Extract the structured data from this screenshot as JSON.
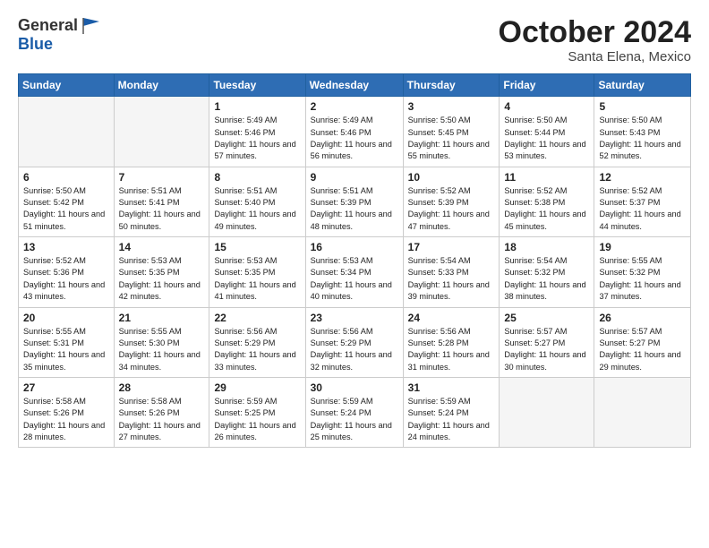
{
  "header": {
    "logo_line1": "General",
    "logo_line2": "Blue",
    "month": "October 2024",
    "location": "Santa Elena, Mexico"
  },
  "weekdays": [
    "Sunday",
    "Monday",
    "Tuesday",
    "Wednesday",
    "Thursday",
    "Friday",
    "Saturday"
  ],
  "weeks": [
    [
      {
        "day": "",
        "info": ""
      },
      {
        "day": "",
        "info": ""
      },
      {
        "day": "1",
        "info": "Sunrise: 5:49 AM\nSunset: 5:46 PM\nDaylight: 11 hours and 57 minutes."
      },
      {
        "day": "2",
        "info": "Sunrise: 5:49 AM\nSunset: 5:46 PM\nDaylight: 11 hours and 56 minutes."
      },
      {
        "day": "3",
        "info": "Sunrise: 5:50 AM\nSunset: 5:45 PM\nDaylight: 11 hours and 55 minutes."
      },
      {
        "day": "4",
        "info": "Sunrise: 5:50 AM\nSunset: 5:44 PM\nDaylight: 11 hours and 53 minutes."
      },
      {
        "day": "5",
        "info": "Sunrise: 5:50 AM\nSunset: 5:43 PM\nDaylight: 11 hours and 52 minutes."
      }
    ],
    [
      {
        "day": "6",
        "info": "Sunrise: 5:50 AM\nSunset: 5:42 PM\nDaylight: 11 hours and 51 minutes."
      },
      {
        "day": "7",
        "info": "Sunrise: 5:51 AM\nSunset: 5:41 PM\nDaylight: 11 hours and 50 minutes."
      },
      {
        "day": "8",
        "info": "Sunrise: 5:51 AM\nSunset: 5:40 PM\nDaylight: 11 hours and 49 minutes."
      },
      {
        "day": "9",
        "info": "Sunrise: 5:51 AM\nSunset: 5:39 PM\nDaylight: 11 hours and 48 minutes."
      },
      {
        "day": "10",
        "info": "Sunrise: 5:52 AM\nSunset: 5:39 PM\nDaylight: 11 hours and 47 minutes."
      },
      {
        "day": "11",
        "info": "Sunrise: 5:52 AM\nSunset: 5:38 PM\nDaylight: 11 hours and 45 minutes."
      },
      {
        "day": "12",
        "info": "Sunrise: 5:52 AM\nSunset: 5:37 PM\nDaylight: 11 hours and 44 minutes."
      }
    ],
    [
      {
        "day": "13",
        "info": "Sunrise: 5:52 AM\nSunset: 5:36 PM\nDaylight: 11 hours and 43 minutes."
      },
      {
        "day": "14",
        "info": "Sunrise: 5:53 AM\nSunset: 5:35 PM\nDaylight: 11 hours and 42 minutes."
      },
      {
        "day": "15",
        "info": "Sunrise: 5:53 AM\nSunset: 5:35 PM\nDaylight: 11 hours and 41 minutes."
      },
      {
        "day": "16",
        "info": "Sunrise: 5:53 AM\nSunset: 5:34 PM\nDaylight: 11 hours and 40 minutes."
      },
      {
        "day": "17",
        "info": "Sunrise: 5:54 AM\nSunset: 5:33 PM\nDaylight: 11 hours and 39 minutes."
      },
      {
        "day": "18",
        "info": "Sunrise: 5:54 AM\nSunset: 5:32 PM\nDaylight: 11 hours and 38 minutes."
      },
      {
        "day": "19",
        "info": "Sunrise: 5:55 AM\nSunset: 5:32 PM\nDaylight: 11 hours and 37 minutes."
      }
    ],
    [
      {
        "day": "20",
        "info": "Sunrise: 5:55 AM\nSunset: 5:31 PM\nDaylight: 11 hours and 35 minutes."
      },
      {
        "day": "21",
        "info": "Sunrise: 5:55 AM\nSunset: 5:30 PM\nDaylight: 11 hours and 34 minutes."
      },
      {
        "day": "22",
        "info": "Sunrise: 5:56 AM\nSunset: 5:29 PM\nDaylight: 11 hours and 33 minutes."
      },
      {
        "day": "23",
        "info": "Sunrise: 5:56 AM\nSunset: 5:29 PM\nDaylight: 11 hours and 32 minutes."
      },
      {
        "day": "24",
        "info": "Sunrise: 5:56 AM\nSunset: 5:28 PM\nDaylight: 11 hours and 31 minutes."
      },
      {
        "day": "25",
        "info": "Sunrise: 5:57 AM\nSunset: 5:27 PM\nDaylight: 11 hours and 30 minutes."
      },
      {
        "day": "26",
        "info": "Sunrise: 5:57 AM\nSunset: 5:27 PM\nDaylight: 11 hours and 29 minutes."
      }
    ],
    [
      {
        "day": "27",
        "info": "Sunrise: 5:58 AM\nSunset: 5:26 PM\nDaylight: 11 hours and 28 minutes."
      },
      {
        "day": "28",
        "info": "Sunrise: 5:58 AM\nSunset: 5:26 PM\nDaylight: 11 hours and 27 minutes."
      },
      {
        "day": "29",
        "info": "Sunrise: 5:59 AM\nSunset: 5:25 PM\nDaylight: 11 hours and 26 minutes."
      },
      {
        "day": "30",
        "info": "Sunrise: 5:59 AM\nSunset: 5:24 PM\nDaylight: 11 hours and 25 minutes."
      },
      {
        "day": "31",
        "info": "Sunrise: 5:59 AM\nSunset: 5:24 PM\nDaylight: 11 hours and 24 minutes."
      },
      {
        "day": "",
        "info": ""
      },
      {
        "day": "",
        "info": ""
      }
    ]
  ]
}
